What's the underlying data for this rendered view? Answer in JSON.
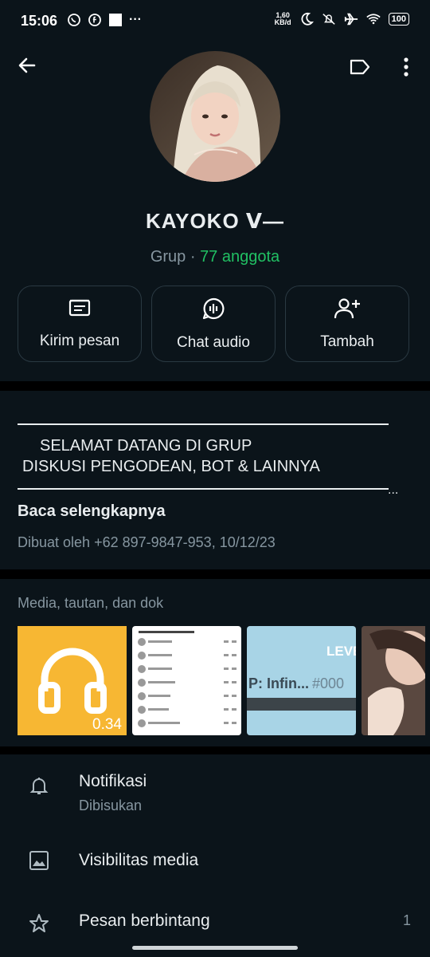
{
  "status_bar": {
    "time": "15:06",
    "net_speed_value": "1,60",
    "net_speed_unit": "KB/d",
    "battery": "100",
    "left_icons": [
      "whatsapp-icon",
      "facebook-icon",
      "square-notification-icon",
      "more-dots"
    ],
    "more": "···"
  },
  "toolbar": {
    "back": "back-arrow-icon",
    "label_action": "label-tag-icon",
    "menu": "more-vert-icon"
  },
  "group": {
    "name": "KAYOKO 𝗩—",
    "type": "Grup",
    "separator": " · ",
    "members": "77 anggota"
  },
  "actions": [
    {
      "label": "Kirim pesan",
      "icon": "message-icon"
    },
    {
      "label": "Chat audio",
      "icon": "audio-chat-icon"
    },
    {
      "label": "Tambah",
      "icon": "add-person-icon"
    }
  ],
  "description": {
    "line1": "SELAMAT DATANG DI GRUP",
    "line2": "DISKUSI PENGODEAN, BOT & LAINNYA",
    "ellipsis": "...",
    "read_more": "Baca selengkapnya",
    "created": "Dibuat oleh +62 897-9847-953, 10/12/23"
  },
  "media": {
    "title": "Media, tautan, dan dok",
    "audio_duration": "0.34",
    "thumb3_text_top": "LEVE",
    "thumb3_text_mid": "P: Infin...",
    "thumb3_text_tag": "#000"
  },
  "settings": [
    {
      "title": "Notifikasi",
      "subtitle": "Dibisukan",
      "icon": "bell-icon"
    },
    {
      "title": "Visibilitas media",
      "icon": "image-icon"
    },
    {
      "title": "Pesan berbintang",
      "count": "1",
      "icon": "star-icon"
    }
  ],
  "colors": {
    "background": "#0b141a",
    "accent_green": "#21c063",
    "muted": "#8696a0",
    "audio_thumb": "#f7b733"
  }
}
